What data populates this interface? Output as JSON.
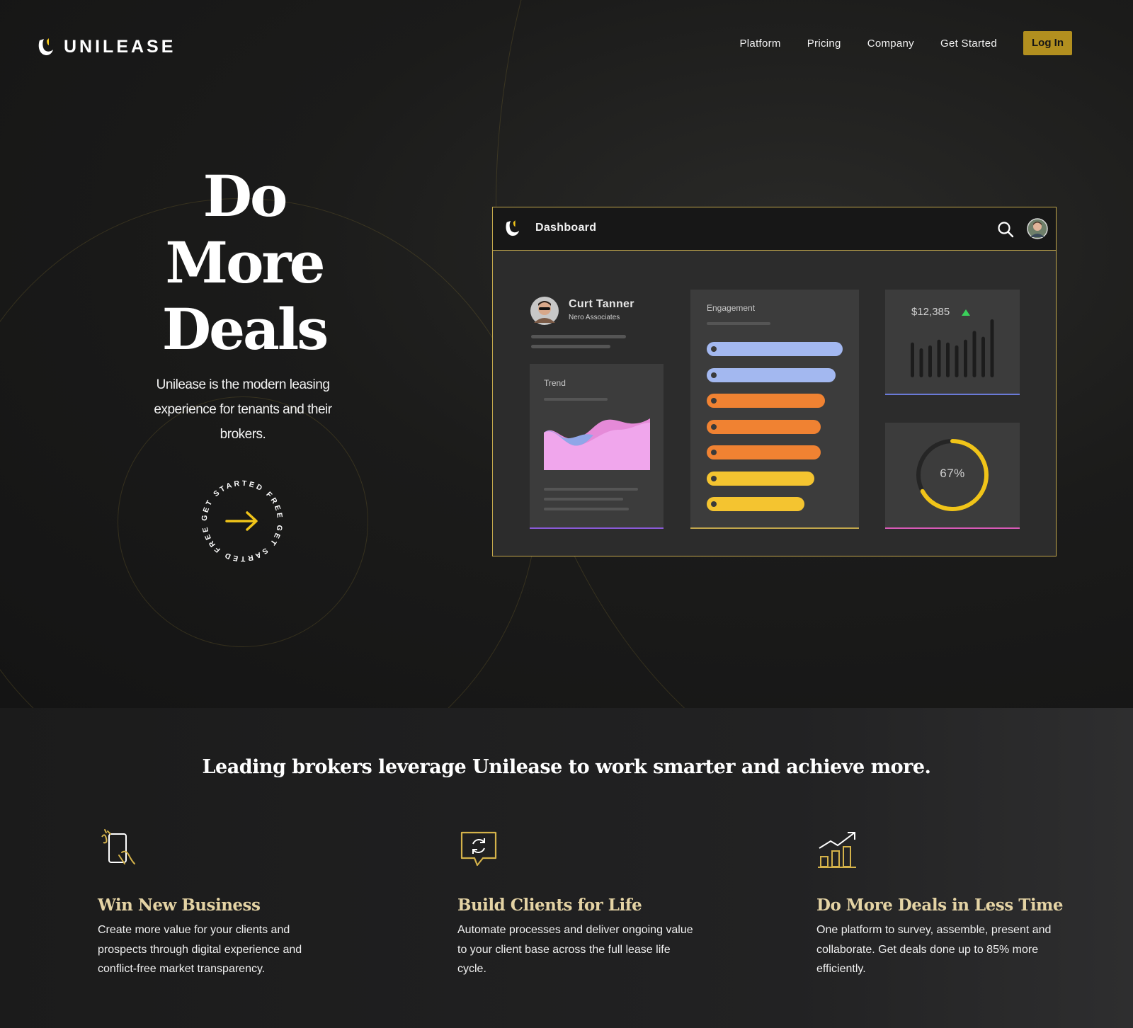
{
  "brand": {
    "name": "UNILEASE"
  },
  "nav": {
    "links": [
      "Platform",
      "Pricing",
      "Company",
      "Get Started"
    ],
    "login_label": "Log In"
  },
  "hero": {
    "headline": [
      "Do",
      "More",
      "Deals"
    ],
    "subtext": "Unilease is the modern leasing experience for tenants and their brokers.",
    "cta_ring_text": "GET STARTED FREE GET SARTED FREE",
    "cta_icon": "arrow-right-icon"
  },
  "dashboard": {
    "title": "Dashboard",
    "user": {
      "name": "Curt Tanner",
      "company": "Nero Associates"
    },
    "trend_label": "Trend",
    "engagement_label": "Engagement",
    "engagement_bars": [
      {
        "fraction": 1.0,
        "color": "#a3b8f0"
      },
      {
        "fraction": 0.95,
        "color": "#a3b8f0"
      },
      {
        "fraction": 0.87,
        "color": "#f08232"
      },
      {
        "fraction": 0.84,
        "color": "#f08232"
      },
      {
        "fraction": 0.84,
        "color": "#f08232"
      },
      {
        "fraction": 0.79,
        "color": "#f4c430"
      },
      {
        "fraction": 0.72,
        "color": "#f4c430"
      }
    ],
    "revenue": {
      "value": "$12,385",
      "trend": "up"
    },
    "revenue_bars": [
      0.6,
      0.5,
      0.55,
      0.65,
      0.6,
      0.55,
      0.65,
      0.8,
      0.7,
      1.0
    ],
    "progress": {
      "label": "67%",
      "value": 0.67
    },
    "colors": {
      "accent": "#c2a74c",
      "gauge": "#f0c419"
    }
  },
  "features_section": {
    "title": "Leading brokers leverage Unilease to work smarter and achieve more.",
    "items": [
      {
        "icon": "touch-phone-icon",
        "title": "Win New Business",
        "desc": "Create more value for your clients and prospects through digital experience and conflict-free market transparency."
      },
      {
        "icon": "chat-refresh-icon",
        "title": "Build Clients for Life",
        "desc": "Automate processes and deliver ongoing value to your client base across the full lease life cycle."
      },
      {
        "icon": "growth-chart-icon",
        "title": "Do More Deals in Less Time",
        "desc": "One platform to survey, assemble, present and collaborate.  Get deals done up to 85% more efficiently."
      }
    ]
  }
}
